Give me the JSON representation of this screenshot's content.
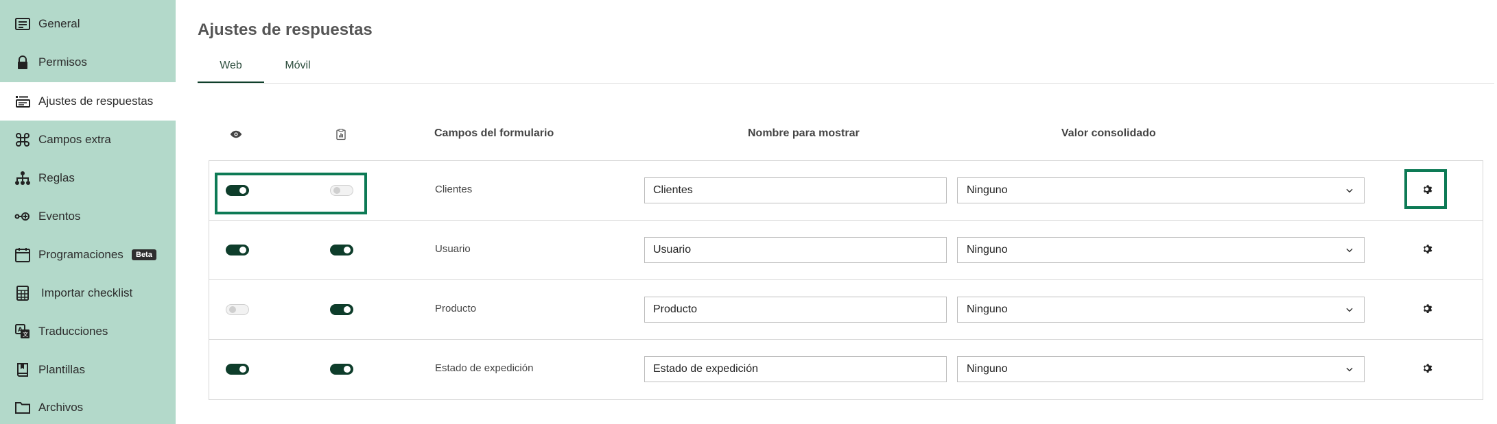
{
  "sidebar": {
    "items": [
      {
        "label": "General",
        "icon": "list-icon",
        "active": false
      },
      {
        "label": "Permisos",
        "icon": "lock-icon",
        "active": false
      },
      {
        "label": "Ajustes de respuestas",
        "icon": "settings-list-icon",
        "active": true
      },
      {
        "label": "Campos extra",
        "icon": "command-icon",
        "active": false
      },
      {
        "label": "Reglas",
        "icon": "hierarchy-icon",
        "active": false
      },
      {
        "label": "Eventos",
        "icon": "event-icon",
        "active": false
      },
      {
        "label": "Programaciones",
        "icon": "calendar-icon",
        "active": false,
        "badge": "Beta"
      },
      {
        "label": "Importar checklist",
        "icon": "spreadsheet-icon",
        "active": false
      },
      {
        "label": "Traducciones",
        "icon": "translate-icon",
        "active": false
      },
      {
        "label": "Plantillas",
        "icon": "book-icon",
        "active": false
      },
      {
        "label": "Archivos",
        "icon": "folder-icon",
        "active": false
      }
    ]
  },
  "page": {
    "title": "Ajustes de respuestas",
    "tabs": [
      {
        "label": "Web",
        "active": true
      },
      {
        "label": "Móvil",
        "active": false
      }
    ]
  },
  "table": {
    "headers": {
      "visible_icon": "eye-icon",
      "report_icon": "clipboard-chart-icon",
      "form_fields": "Campos del formulario",
      "display_name": "Nombre para mostrar",
      "consolidated_value": "Valor consolidado"
    },
    "rows": [
      {
        "field": "Clientes",
        "display_name": "Clientes",
        "consolidated": "Ninguno",
        "visible": true,
        "report": false
      },
      {
        "field": "Usuario",
        "display_name": "Usuario",
        "consolidated": "Ninguno",
        "visible": true,
        "report": true
      },
      {
        "field": "Producto",
        "display_name": "Producto",
        "consolidated": "Ninguno",
        "visible": false,
        "report": true
      },
      {
        "field": "Estado de expedición",
        "display_name": "Estado de expedición",
        "consolidated": "Ninguno",
        "visible": true,
        "report": true
      }
    ]
  },
  "colors": {
    "sidebar_bg": "#b3d9ca",
    "toggle_on": "#0e3d2b",
    "highlight": "#0d7a55",
    "tab_underline": "#0f3f2a"
  }
}
